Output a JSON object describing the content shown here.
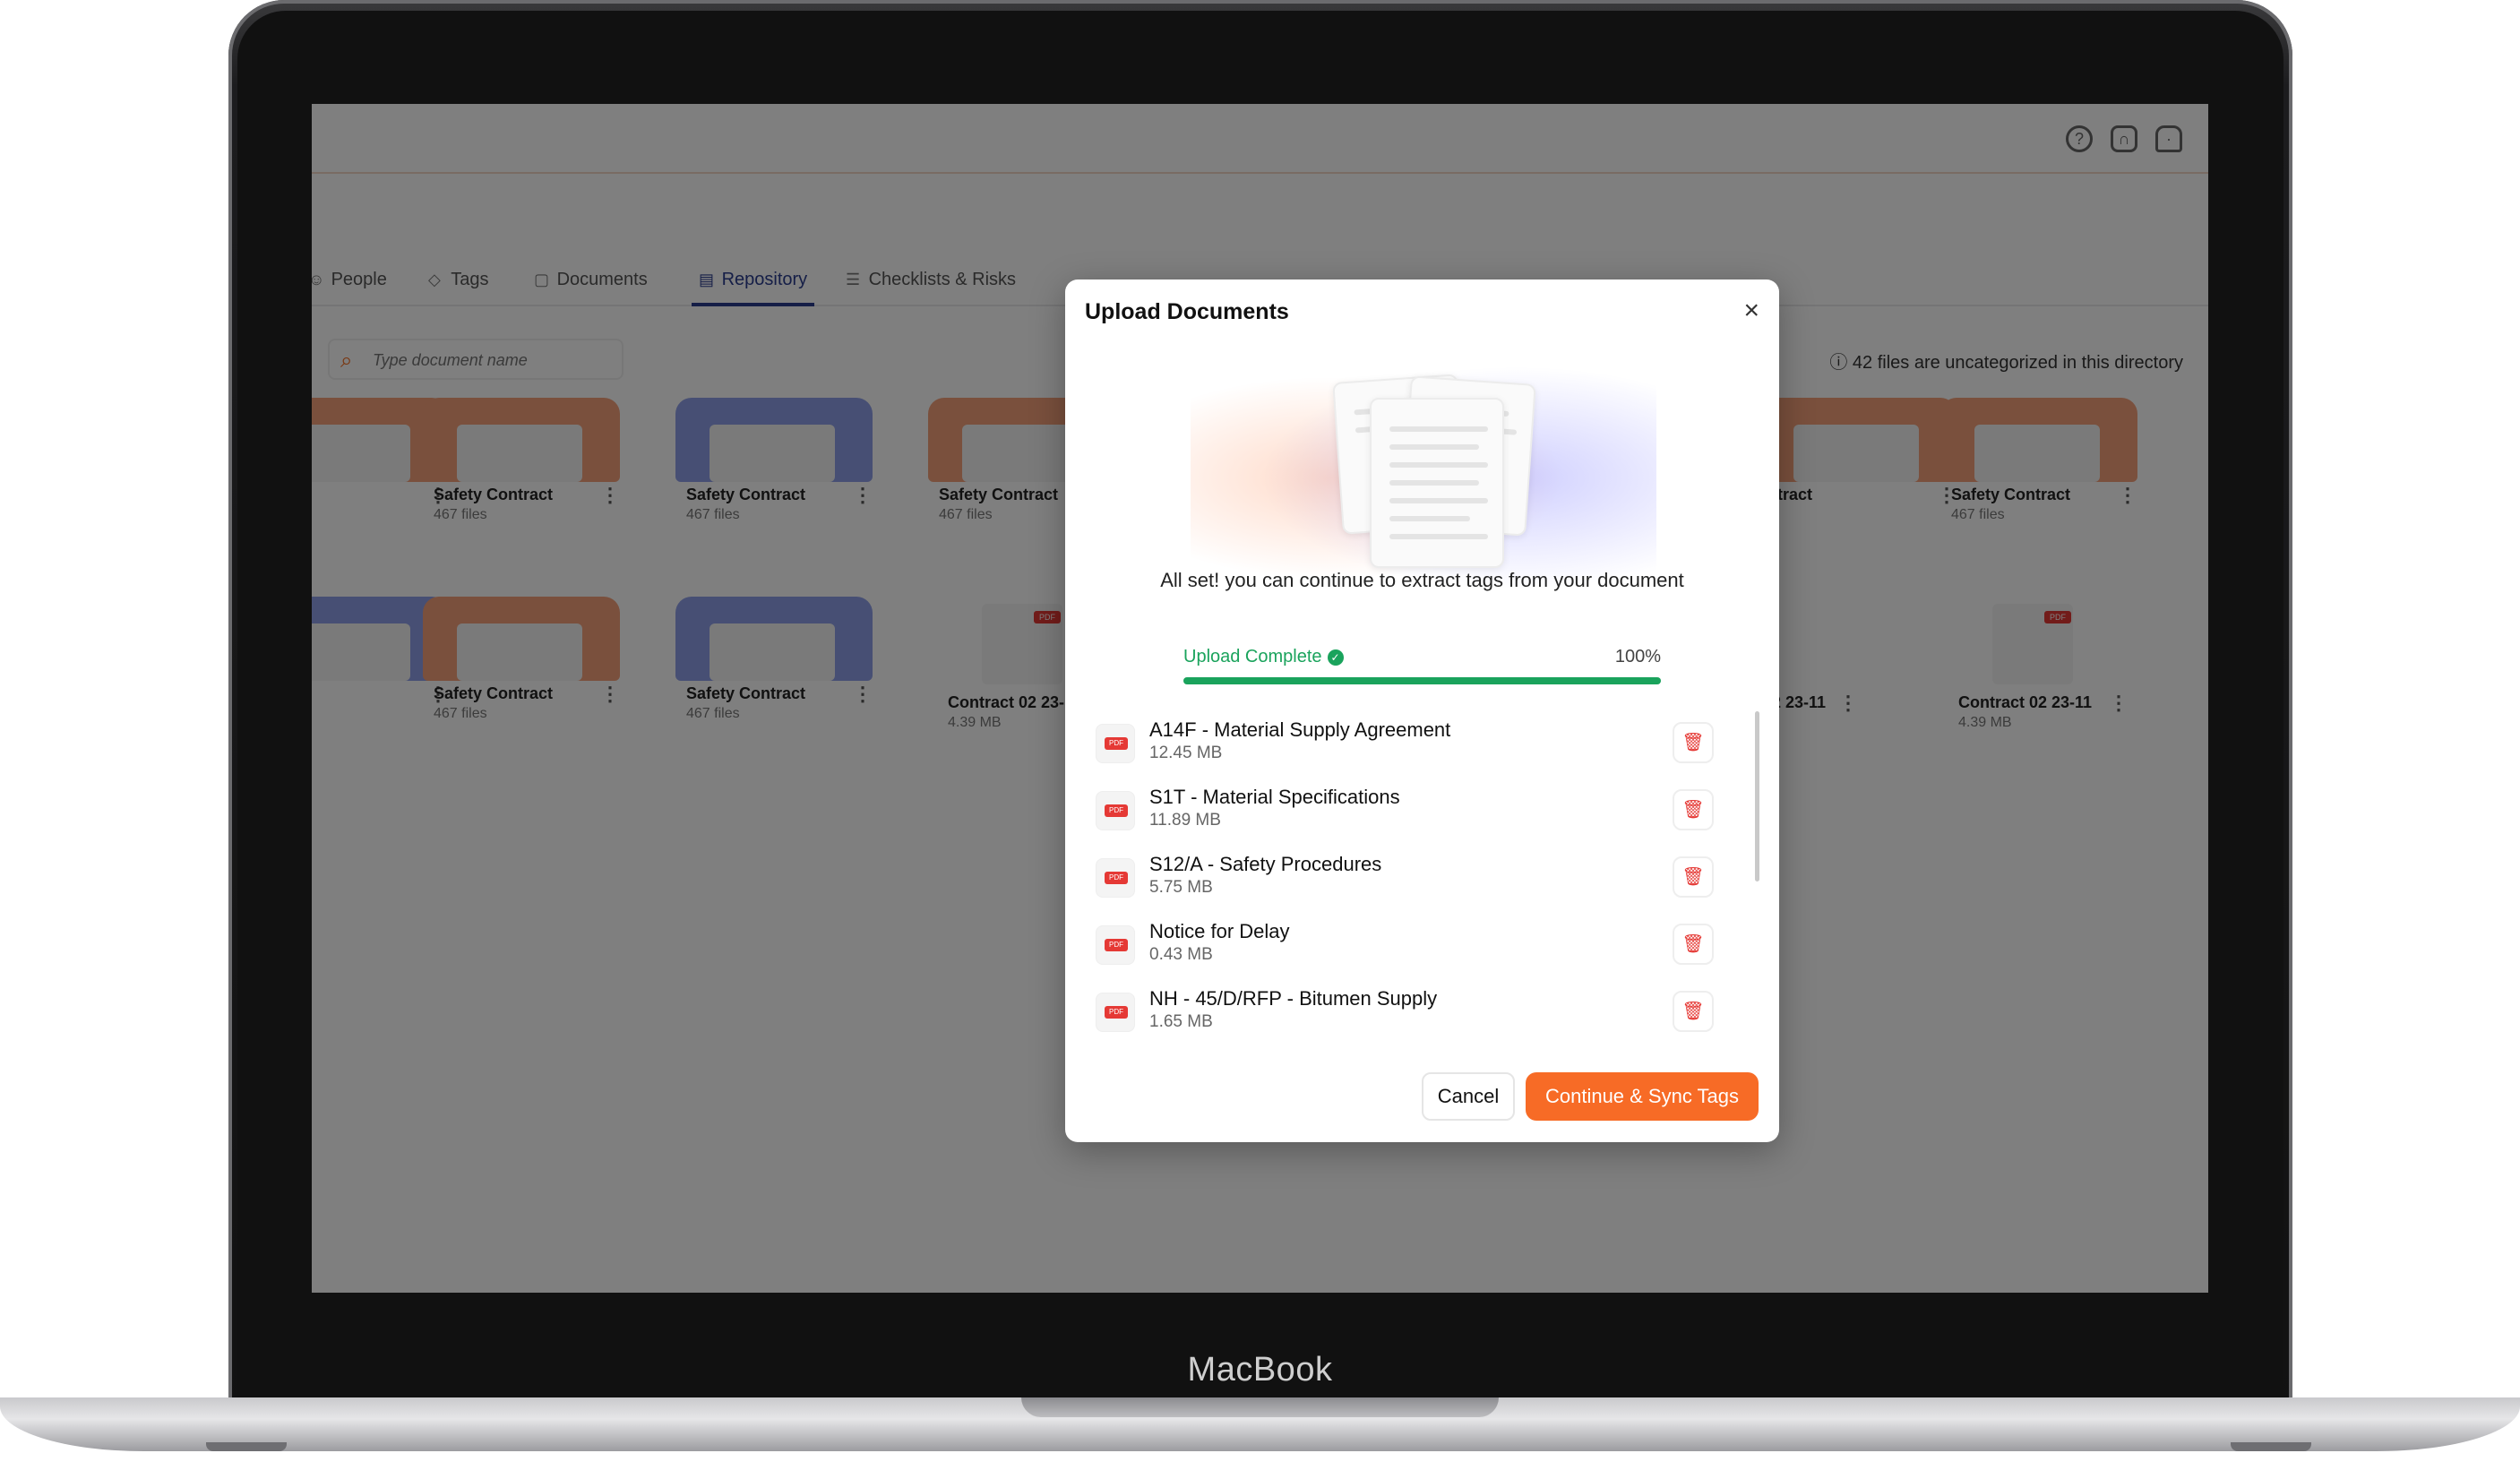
{
  "device": {
    "label": "MacBook"
  },
  "tabs": [
    {
      "label": "People",
      "icon": "people-icon"
    },
    {
      "label": "Tags",
      "icon": "tag-icon"
    },
    {
      "label": "Documents",
      "icon": "documents-icon"
    },
    {
      "label": "Repository",
      "icon": "repository-icon",
      "active": true
    },
    {
      "label": "Checklists & Risks",
      "icon": "checklist-icon"
    }
  ],
  "search": {
    "placeholder": "Type document name"
  },
  "uncategorized_notice": "42 files are uncategorized in this directory",
  "folders": [
    {
      "name": "Safety Contract",
      "meta": "467 files"
    },
    {
      "name": "Safety Contract",
      "meta": "467 files"
    },
    {
      "name": "Safety Contract",
      "meta": "467 files"
    },
    {
      "name": "Safety Contract",
      "meta": "467 files"
    },
    {
      "name": "Safety Contract",
      "meta": "467 files"
    },
    {
      "name": "tract",
      "meta": ""
    }
  ],
  "pdf_cards": [
    {
      "name": "Contract 02 23-11",
      "meta": "4.39 MB"
    },
    {
      "name": "Contract 02 23-11",
      "meta": "4.39 MB"
    },
    {
      "name": "2 23-11",
      "meta": ""
    }
  ],
  "pdf_tag": "PDF",
  "modal": {
    "title": "Upload Documents",
    "message": "All set! you can continue to extract tags from your document",
    "status": "Upload Complete",
    "progress_label": "100%",
    "progress": 1.0,
    "files": [
      {
        "name": "A14F - Material Supply Agreement",
        "size": "12.45 MB"
      },
      {
        "name": "S1T - Material Specifications",
        "size": "11.89 MB"
      },
      {
        "name": "S12/A - Safety Procedures",
        "size": "5.75 MB"
      },
      {
        "name": "Notice for Delay",
        "size": "0.43 MB"
      },
      {
        "name": "NH - 45/D/RFP - Bitumen Supply",
        "size": "1.65 MB"
      }
    ],
    "cancel_label": "Cancel",
    "continue_label": "Continue & Sync Tags"
  },
  "colors": {
    "accent": "#f76b26",
    "success": "#1aa35c",
    "active_tab": "#2a3d8f",
    "danger": "#e53935"
  }
}
